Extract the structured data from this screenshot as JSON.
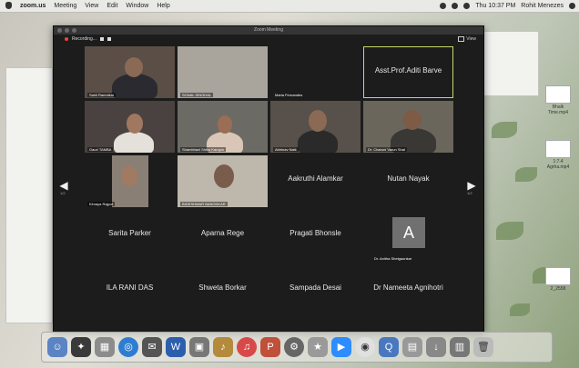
{
  "menubar": {
    "app_name": "zoom.us",
    "menus": [
      "Meeting",
      "View",
      "Edit",
      "Window",
      "Help"
    ],
    "clock": "Thu 10:37 PM",
    "user": "Rohit Menezes"
  },
  "zoom": {
    "window_title": "Zoom Meeting",
    "recording_label": "Recording...",
    "view_label": "View",
    "page_prev": "1/2",
    "page_next": "1/2"
  },
  "participants": [
    {
      "name": "Sahil Ramnikar",
      "type": "video"
    },
    {
      "name": "SONAL SINGHAL",
      "type": "video"
    },
    {
      "name": "Maria Fernandes",
      "type": "name"
    },
    {
      "name": "Asst.Prof.Aditi Barve",
      "type": "name",
      "active": true
    },
    {
      "name": "Gauri TAMBA",
      "type": "video"
    },
    {
      "name": "Shambhavi Shiva Karapin",
      "type": "video"
    },
    {
      "name": "Abhinav Naik",
      "type": "video"
    },
    {
      "name": "Dr. Charuni Varun Shal",
      "type": "video"
    },
    {
      "name": "Kimaya Rajput",
      "type": "video"
    },
    {
      "name": "BIDESHWAR BANODKAR",
      "type": "video"
    },
    {
      "name": "Aakruthi Alamkar",
      "type": "name"
    },
    {
      "name": "Nutan Nayak",
      "type": "name"
    },
    {
      "name": "Sarita Parker",
      "type": "name"
    },
    {
      "name": "Aparna Rege",
      "type": "name"
    },
    {
      "name": "Pragati Bhonsle",
      "type": "name"
    },
    {
      "name": "Dr. Anitha Shetgaonkar",
      "type": "avatar",
      "initial": "A"
    },
    {
      "name": "ILA RANI DAS",
      "type": "name"
    },
    {
      "name": "Shweta Borkar",
      "type": "name"
    },
    {
      "name": "Sampada Desai",
      "type": "name"
    },
    {
      "name": "Dr Nameeta Agnihotri",
      "type": "name"
    }
  ],
  "desktop_files": [
    "Bhalk Time.mp4",
    "1:7.4 Agrha.mp4",
    "2_2558"
  ]
}
